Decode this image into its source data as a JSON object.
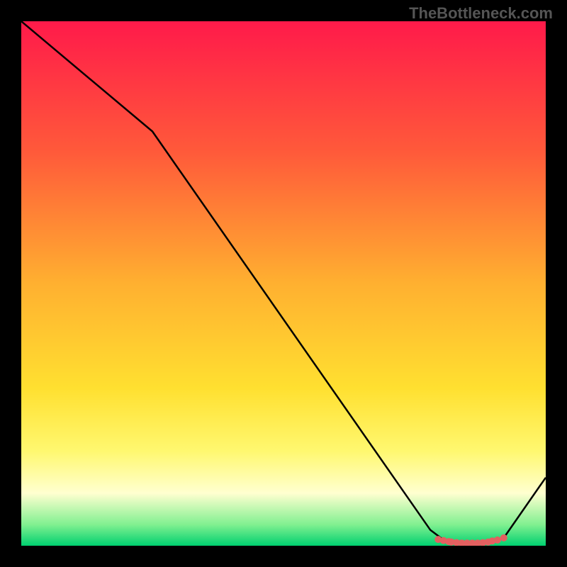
{
  "watermark": "TheBottleneck.com",
  "chart_data": {
    "type": "line",
    "title": "",
    "xlabel": "",
    "ylabel": "",
    "xlim": [
      0,
      100
    ],
    "ylim": [
      0,
      100
    ],
    "gradient_stops": [
      {
        "offset": 0.0,
        "color": "#ff1a4a"
      },
      {
        "offset": 0.25,
        "color": "#ff5a3a"
      },
      {
        "offset": 0.5,
        "color": "#ffb030"
      },
      {
        "offset": 0.7,
        "color": "#ffe030"
      },
      {
        "offset": 0.82,
        "color": "#fff870"
      },
      {
        "offset": 0.9,
        "color": "#ffffd0"
      },
      {
        "offset": 0.96,
        "color": "#80f090"
      },
      {
        "offset": 1.0,
        "color": "#00d070"
      }
    ],
    "series": [
      {
        "name": "curve",
        "x": [
          0,
          25,
          78,
          80,
          82,
          84,
          86,
          88,
          90,
          92,
          100
        ],
        "y": [
          100,
          79,
          3,
          1.5,
          0.8,
          0.5,
          0.5,
          0.5,
          0.8,
          1.5,
          13
        ]
      }
    ],
    "markers": {
      "name": "highlight-points",
      "color": "#e36060",
      "x": [
        79.5,
        80.5,
        81.5,
        82.0,
        83.0,
        84.0,
        85.0,
        86.0,
        87.0,
        88.0,
        89.0,
        89.8,
        90.8,
        92.0
      ],
      "y": [
        1.2,
        1.0,
        0.8,
        0.7,
        0.6,
        0.5,
        0.5,
        0.5,
        0.5,
        0.6,
        0.7,
        0.9,
        1.1,
        1.5
      ]
    }
  }
}
